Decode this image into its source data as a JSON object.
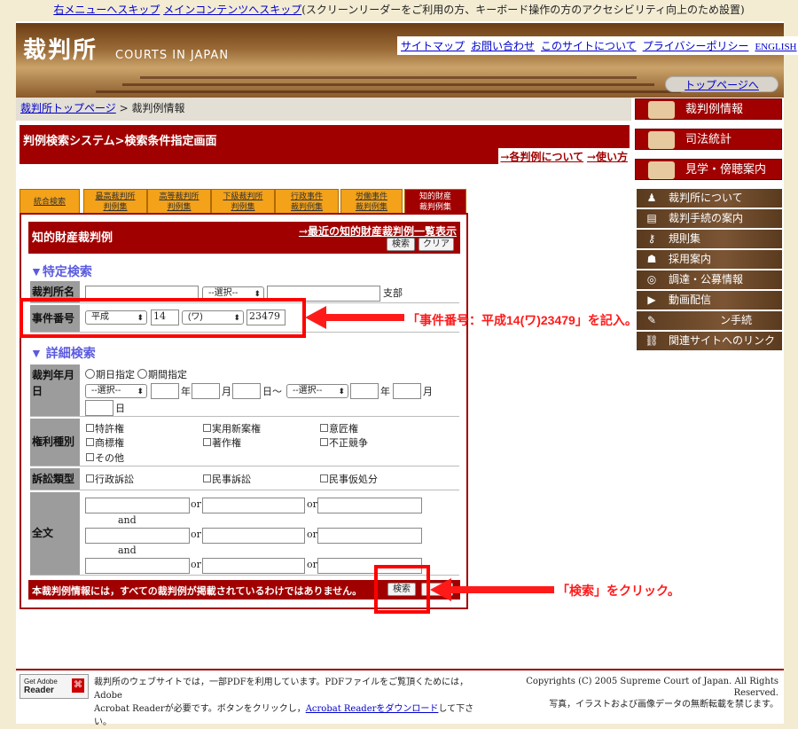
{
  "skip_links": {
    "link1": "右メニューへスキップ",
    "link2": "メインコンテンツへスキップ",
    "note": "(スクリーンリーダーをご利用の方、キーボード操作の方のアクセシビリティ向上のため設置)"
  },
  "header": {
    "logo": "裁判所",
    "logo_en": "COURTS IN JAPAN",
    "links": [
      "サイトマップ",
      "お問い合わせ",
      "このサイトについて",
      "プライバシーポリシー",
      "ENGLISH"
    ],
    "top_button": "トップページへ"
  },
  "breadcrumb": {
    "home": "裁判所トップページ",
    "sep": " > ",
    "current": "裁判例情報"
  },
  "title": {
    "text": "判例検索システム>検索条件指定画面",
    "links": [
      "→各判例について",
      "→使い方"
    ]
  },
  "tabs": [
    {
      "l1": "統合検索",
      "l2": ""
    },
    {
      "l1": "最高裁判所",
      "l2": "判例集"
    },
    {
      "l1": "高等裁判所",
      "l2": "判例集"
    },
    {
      "l1": "下級裁判所",
      "l2": "判例集"
    },
    {
      "l1": "行政事件",
      "l2": "裁判例集"
    },
    {
      "l1": "労働事件",
      "l2": "裁判例集"
    },
    {
      "l1": "知的財産",
      "l2": "裁判例集"
    }
  ],
  "panel": {
    "title": "知的財産裁判例",
    "recent_link": "→最近の知的財産裁判例一覧表示",
    "search_btn": "検索",
    "clear_btn": "クリア"
  },
  "specific": {
    "heading": "▼特定検索",
    "court_label": "裁判所名",
    "court_select": "--選択--",
    "branch": "支部",
    "case_label": "事件番号",
    "era": "平成",
    "year": "14",
    "type": "(ワ)",
    "number": "23479"
  },
  "detail": {
    "heading": "▼ 詳細検索",
    "date_label": "裁判年月日",
    "opt1": "期日指定",
    "opt2": "期間指定",
    "select": "--選択--",
    "y": "年",
    "m": "月",
    "d": "日",
    "tilde": "日〜",
    "rights_label": "権利種別",
    "rights": [
      "特許権",
      "実用新案権",
      "意匠権",
      "商標権",
      "著作権",
      "不正競争",
      "その他"
    ],
    "suit_label": "訴訟類型",
    "suits": [
      "行政訴訟",
      "民事訴訟",
      "民事仮処分"
    ],
    "full_label": "全文",
    "or": "or",
    "and": "and"
  },
  "bottom": {
    "note": "本裁判例情報には，すべての裁判例が掲載されているわけではありません。",
    "search": "検索"
  },
  "annotations": {
    "case": "「事件番号：平成14(ワ)23479」を記入。",
    "click": "「検索」をクリック。"
  },
  "sidebar": {
    "red": [
      "裁判例情報",
      "司法統計",
      "見学・傍聴案内"
    ],
    "brown": [
      "裁判所について",
      "裁判手続の案内",
      "規則集",
      "採用案内",
      "調達・公募情報",
      "動画配信",
      "ン手続",
      "関連サイトへのリンク"
    ]
  },
  "footer": {
    "badge1": "Get Adobe",
    "badge2": "Reader",
    "text1": "裁判所のウェブサイトでは，一部PDFを利用しています。PDFファイルをご覧頂くためには，Adobe",
    "text2": "Acrobat Readerが必要です。ボタンをクリックし，",
    "link": "Acrobat Readerをダウンロード",
    "text3": "して下さい。",
    "copy1": "Copyrights (C) 2005 Supreme Court of Japan. All Rights Reserved.",
    "copy2": "写真，イラストおよび画像データの無断転載を禁じます。"
  }
}
